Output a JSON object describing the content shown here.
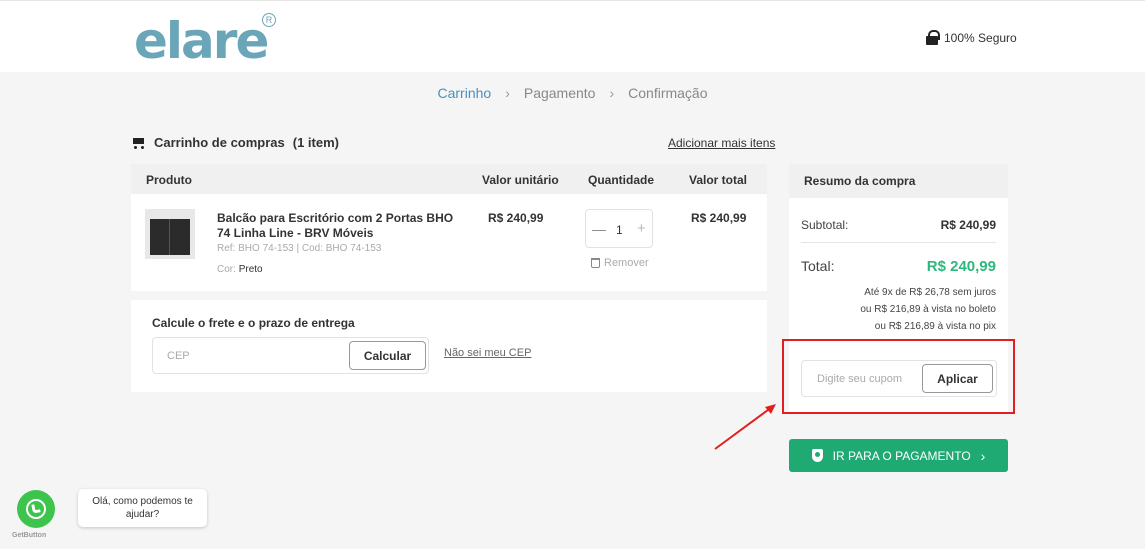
{
  "header": {
    "logo_text": "elare",
    "logo_registered": "R",
    "secure_label": "100% Seguro"
  },
  "steps": [
    {
      "label": "Carrinho",
      "active": true
    },
    {
      "label": "Pagamento",
      "active": false
    },
    {
      "label": "Confirmação",
      "active": false
    }
  ],
  "cart": {
    "title": "Carrinho de compras",
    "count": "(1 item)",
    "add_more": "Adicionar mais itens",
    "columns": {
      "product": "Produto",
      "unit_price": "Valor unitário",
      "quantity": "Quantidade",
      "total": "Valor total"
    },
    "item": {
      "name": "Balcão para Escritório com 2 Portas BHO 74 Linha Line - BRV Móveis",
      "ref": "Ref: BHO 74-153  |  Cod: BHO 74-153",
      "color_label": "Cor:",
      "color_value": "Preto",
      "unit_price": "R$ 240,99",
      "quantity": "1",
      "total": "R$ 240,99",
      "remove_label": "Remover"
    }
  },
  "shipping": {
    "title": "Calcule o frete e o prazo de entrega",
    "cep_placeholder": "CEP",
    "calc_button": "Calcular",
    "unknown_cep": "Não sei meu CEP"
  },
  "summary": {
    "title": "Resumo da compra",
    "subtotal_label": "Subtotal:",
    "subtotal_value": "R$ 240,99",
    "total_label": "Total:",
    "total_value": "R$ 240,99",
    "installments": [
      "Até 9x de R$ 26,78 sem juros",
      "ou R$ 216,89 à vista no boleto",
      "ou R$ 216,89 à vista no pix"
    ],
    "coupon_placeholder": "Digite seu cupom",
    "apply_button": "Aplicar"
  },
  "pay_button": "IR PARA O PAGAMENTO",
  "whatsapp": {
    "bubble": "Olá, como podemos te ajudar?",
    "brand": "GetButton"
  },
  "colors": {
    "accent_green": "#1faa74",
    "total_green": "#2db87d",
    "step_active": "#4a8fbf",
    "highlight_red": "#e02020",
    "logo": "#6aa6b8"
  }
}
